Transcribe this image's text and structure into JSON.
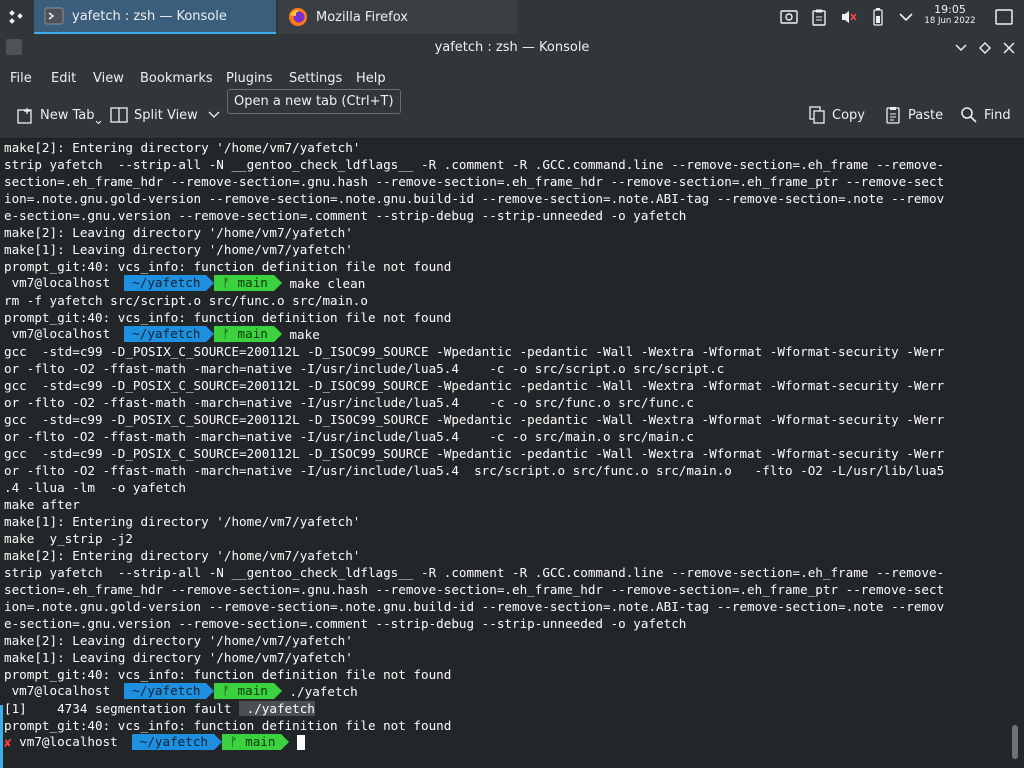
{
  "taskbar": {
    "tasks": [
      {
        "label": "yafetch : zsh — Konsole",
        "icon": "konsole-icon"
      },
      {
        "label": "Mozilla Firefox",
        "icon": "firefox-icon"
      }
    ],
    "clock": {
      "time": "19:05",
      "date": "18 Jun 2022"
    }
  },
  "window": {
    "title": "yafetch : zsh — Konsole"
  },
  "menu": {
    "file": "File",
    "edit": "Edit",
    "view": "View",
    "bookmarks": "Bookmarks",
    "plugins": "Plugins",
    "settings": "Settings",
    "help": "Help"
  },
  "tooltip": "Open a new tab (Ctrl+T)",
  "toolbar": {
    "new_tab": "New Tab",
    "split_view": "Split View",
    "copy": "Copy",
    "paste": "Paste",
    "find": "Find"
  },
  "prompt": {
    "user": " vm7@localhost",
    "dir": "~/yafetch",
    "git": "ᚠ main"
  },
  "terminal": {
    "l0": "make[2]: Entering directory '/home/vm7/yafetch'",
    "l1": "strip yafetch  --strip-all -N __gentoo_check_ldflags__ -R .comment -R .GCC.command.line --remove-section=.eh_frame --remove-",
    "l2": "section=.eh_frame_hdr --remove-section=.gnu.hash --remove-section=.eh_frame_hdr --remove-section=.eh_frame_ptr --remove-sect",
    "l3": "ion=.note.gnu.gold-version --remove-section=.note.gnu.build-id --remove-section=.note.ABI-tag --remove-section=.note --remov",
    "l4": "e-section=.gnu.version --remove-section=.comment --strip-debug --strip-unneeded -o yafetch",
    "l5": "make[2]: Leaving directory '/home/vm7/yafetch'",
    "l6": "make[1]: Leaving directory '/home/vm7/yafetch'",
    "l7": "prompt_git:40: vcs_info: function definition file not found",
    "cmd1": " make clean",
    "l9": "rm -f yafetch src/script.o src/func.o src/main.o",
    "l10": "prompt_git:40: vcs_info: function definition file not found",
    "cmd2": " make",
    "l12": "gcc  -std=c99 -D_POSIX_C_SOURCE=200112L -D_ISOC99_SOURCE -Wpedantic -pedantic -Wall -Wextra -Wformat -Wformat-security -Werr",
    "l13": "or -flto -O2 -ffast-math -march=native -I/usr/include/lua5.4    -c -o src/script.o src/script.c",
    "l14": "gcc  -std=c99 -D_POSIX_C_SOURCE=200112L -D_ISOC99_SOURCE -Wpedantic -pedantic -Wall -Wextra -Wformat -Wformat-security -Werr",
    "l15": "or -flto -O2 -ffast-math -march=native -I/usr/include/lua5.4    -c -o src/func.o src/func.c",
    "l16": "gcc  -std=c99 -D_POSIX_C_SOURCE=200112L -D_ISOC99_SOURCE -Wpedantic -pedantic -Wall -Wextra -Wformat -Wformat-security -Werr",
    "l17": "or -flto -O2 -ffast-math -march=native -I/usr/include/lua5.4    -c -o src/main.o src/main.c",
    "l18": "gcc  -std=c99 -D_POSIX_C_SOURCE=200112L -D_ISOC99_SOURCE -Wpedantic -pedantic -Wall -Wextra -Wformat -Wformat-security -Werr",
    "l19": "or -flto -O2 -ffast-math -march=native -I/usr/include/lua5.4  src/script.o src/func.o src/main.o   -flto -O2 -L/usr/lib/lua5",
    "l20": ".4 -llua -lm  -o yafetch",
    "l21": "make after",
    "l22": "make[1]: Entering directory '/home/vm7/yafetch'",
    "l23": "make  y_strip -j2",
    "l24": "make[2]: Entering directory '/home/vm7/yafetch'",
    "l25": "strip yafetch  --strip-all -N __gentoo_check_ldflags__ -R .comment -R .GCC.command.line --remove-section=.eh_frame --remove-",
    "l26": "section=.eh_frame_hdr --remove-section=.gnu.hash --remove-section=.eh_frame_hdr --remove-section=.eh_frame_ptr --remove-sect",
    "l27": "ion=.note.gnu.gold-version --remove-section=.note.gnu.build-id --remove-section=.note.ABI-tag --remove-section=.note --remov",
    "l28": "e-section=.gnu.version --remove-section=.comment --strip-debug --strip-unneeded -o yafetch",
    "l29": "make[2]: Leaving directory '/home/vm7/yafetch'",
    "l30": "make[1]: Leaving directory '/home/vm7/yafetch'",
    "l31": "prompt_git:40: vcs_info: function definition file not found",
    "cmd3": " ./yafetch",
    "l33a": "[1]    4734 segmentation fault ",
    "l33b": " ./yafetch",
    "l34": "prompt_git:40: vcs_info: function definition file not found",
    "err_mark": "✘",
    "last_user": " vm7@localhost"
  },
  "colors": {
    "dir_segment": "#1f8fe0",
    "git_segment": "#3cd23f",
    "accent": "#3daee9",
    "error": "#ff3b3b"
  }
}
